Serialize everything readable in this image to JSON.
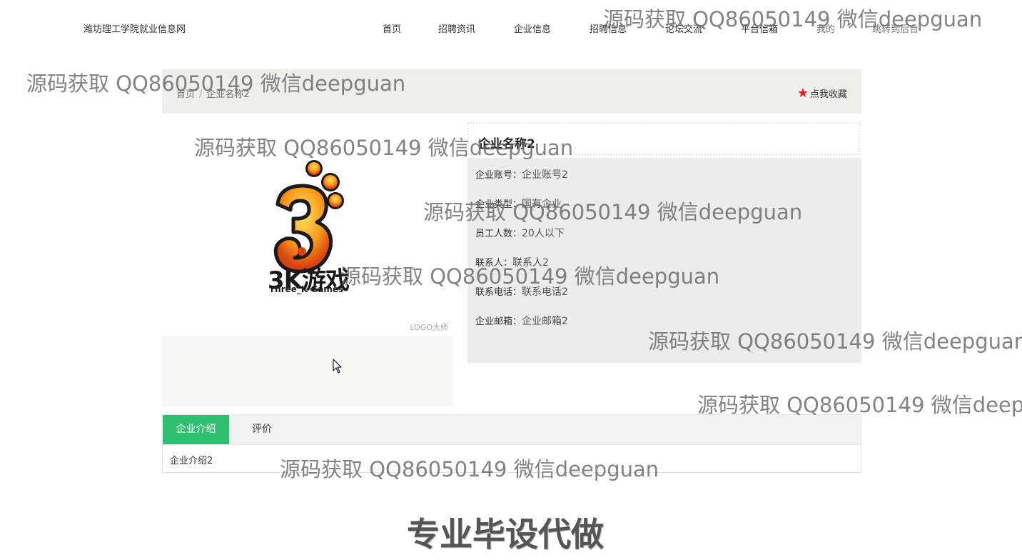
{
  "site": {
    "name": "潍坊理工学院就业信息网"
  },
  "nav": {
    "items": [
      {
        "label": "首页"
      },
      {
        "label": "招聘资讯"
      },
      {
        "label": "企业信息"
      },
      {
        "label": "招聘信息"
      },
      {
        "label": "论坛交流"
      },
      {
        "label": "平台信箱"
      },
      {
        "label": "我的"
      },
      {
        "label": "跳转到后台"
      }
    ]
  },
  "breadcrumb": {
    "home": "首页",
    "separator": "/",
    "current": "企业名称2"
  },
  "favorite": {
    "label": "点我收藏",
    "icon": "star-icon",
    "icon_color": "#e01b1b"
  },
  "logo": {
    "brand_text": "3K游戏",
    "brand_sub": "Three_K Games",
    "credit": "LOGO大师"
  },
  "company": {
    "title": "企业名称2",
    "fields": [
      {
        "key": "企业账号：",
        "value": "企业账号2"
      },
      {
        "key": "企业类型：",
        "value": "国有企业"
      },
      {
        "key": "员工人数：",
        "value": "20人以下"
      },
      {
        "key": "联系人：",
        "value": "联系人2"
      },
      {
        "key": "联系电话：",
        "value": "联系电话2"
      },
      {
        "key": "企业邮箱：",
        "value": "企业邮箱2"
      }
    ]
  },
  "tabs": {
    "items": [
      {
        "label": "企业介绍"
      },
      {
        "label": "评价"
      }
    ],
    "content": "企业介绍2",
    "active_color": "#2fbf71"
  },
  "overlay": {
    "watermark": "源码获取 QQ86050149 微信deepguan",
    "promo": "专业毕设代做"
  }
}
